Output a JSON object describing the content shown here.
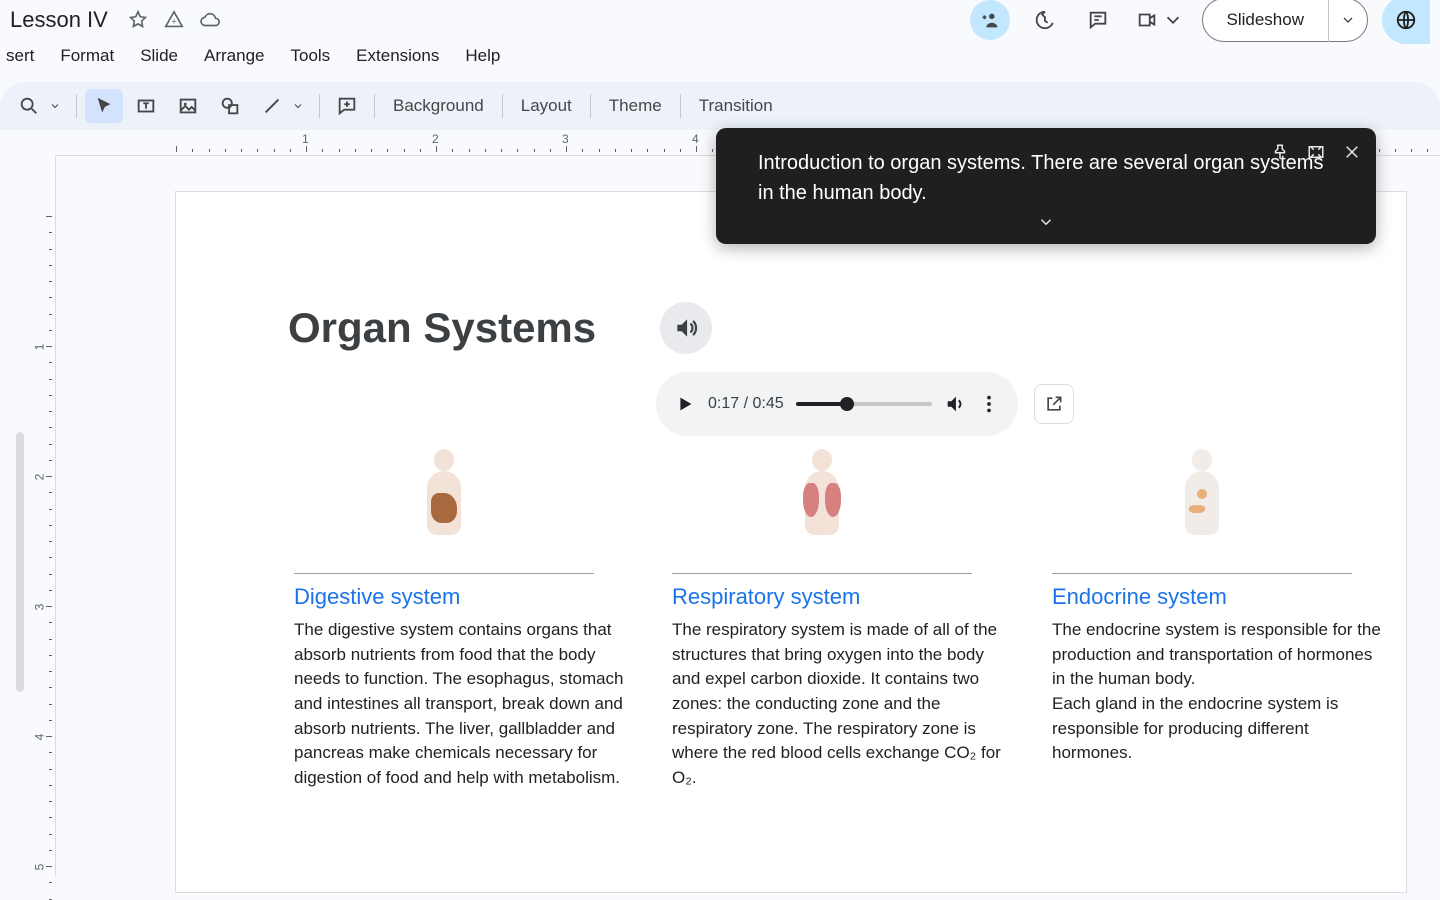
{
  "doc_title": "Lesson IV",
  "menus": {
    "insert": "sert",
    "format": "Format",
    "slide": "Slide",
    "arrange": "Arrange",
    "tools": "Tools",
    "extensions": "Extensions",
    "help": "Help"
  },
  "toolbar": {
    "background": "Background",
    "layout": "Layout",
    "theme": "Theme",
    "transition": "Transition"
  },
  "slideshow_label": "Slideshow",
  "caption_text": "Introduction to organ systems. There are several organ systems in the human body.",
  "audio": {
    "current": "0:17",
    "total": "0:45",
    "progress_percent": 38
  },
  "slide_title": "Organ Systems",
  "columns": [
    {
      "title": "Digestive system",
      "body": "The digestive system contains organs that absorb nutrients from food that the body needs to function. The esophagus, stomach and intestines all transport, break down and absorb nutrients. The liver, gallbladder and pancreas make chemicals necessary for digestion of food and help with metabolism."
    },
    {
      "title": "Respiratory system",
      "body": "The respiratory system is made of all of the structures that bring oxygen into the body and expel carbon dioxide. It contains two zones: the conducting zone and the respiratory zone. The respiratory zone is where the red blood cells exchange CO₂ for O₂."
    },
    {
      "title": "Endocrine system",
      "body": "The endocrine system is responsible for the production and transportation of hormones in the human body.\nEach gland in the endocrine system is responsible for producing different hormones."
    }
  ],
  "ruler_h": [
    "1",
    "2",
    "3",
    "4"
  ],
  "ruler_v": [
    "1",
    "2",
    "3",
    "4",
    "5"
  ]
}
